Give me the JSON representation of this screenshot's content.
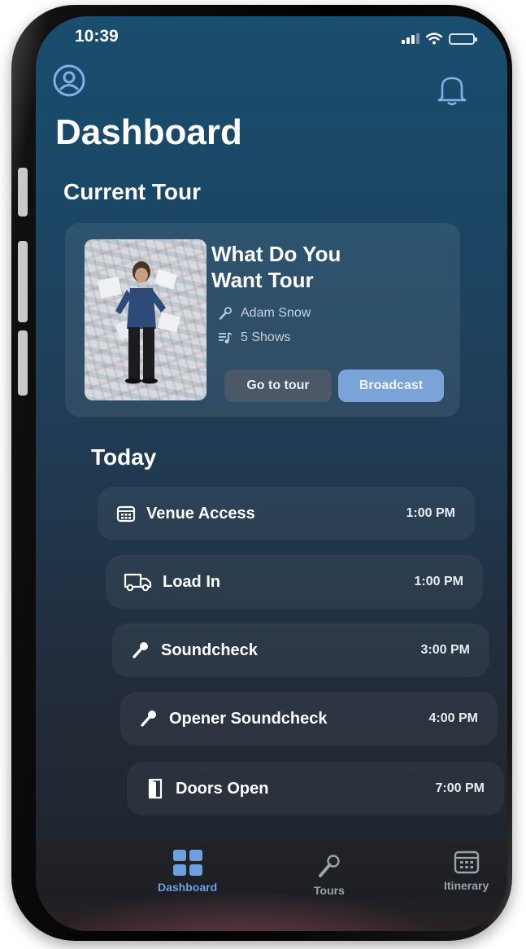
{
  "status": {
    "time": "10:39"
  },
  "header": {
    "title": "Dashboard"
  },
  "current_tour": {
    "section_label": "Current Tour",
    "name": "What Do You Want Tour",
    "artist": "Adam Snow",
    "shows": "5 Shows",
    "go_button": "Go to tour",
    "broadcast_button": "Broadcast"
  },
  "today": {
    "section_label": "Today",
    "items": [
      {
        "label": "Venue Access",
        "time": "1:00 PM",
        "icon": "calendar-icon"
      },
      {
        "label": "Load In",
        "time": "1:00 PM",
        "icon": "truck-icon"
      },
      {
        "label": "Soundcheck",
        "time": "3:00 PM",
        "icon": "microphone-icon"
      },
      {
        "label": "Opener Soundcheck",
        "time": "4:00 PM",
        "icon": "microphone-icon"
      },
      {
        "label": "Doors Open",
        "time": "7:00 PM",
        "icon": "door-icon"
      }
    ]
  },
  "tabs": [
    {
      "label": "Dashboard",
      "icon": "grid-icon",
      "active": true
    },
    {
      "label": "Tours",
      "icon": "microphone-icon",
      "active": false
    },
    {
      "label": "Itinerary",
      "icon": "calendar-icon",
      "active": false
    }
  ],
  "colors": {
    "accent": "#7aa3d8",
    "active_tab": "#6e9fe0",
    "background_top": "#1a4d6e",
    "background_bottom": "#1f2229"
  }
}
